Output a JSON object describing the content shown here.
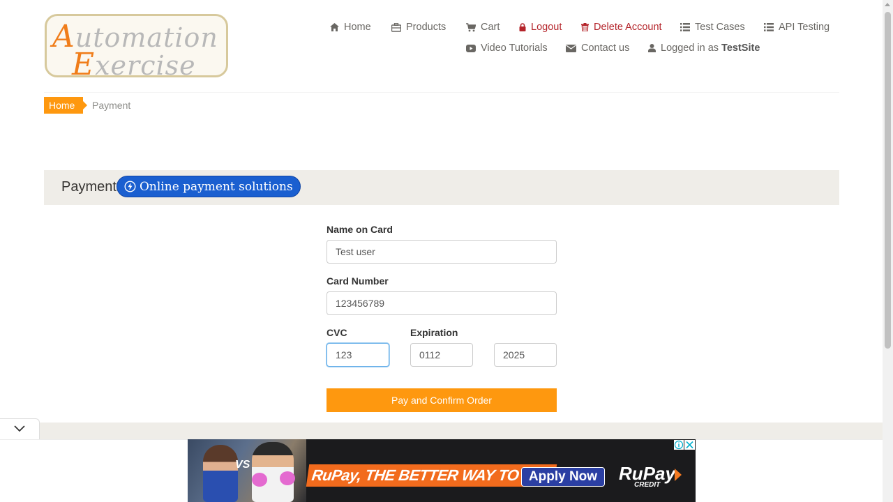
{
  "logo": {
    "line1_cap": "A",
    "line1_rest": "utomation",
    "line2_cap": "E",
    "line2_rest": "xercise"
  },
  "nav": {
    "home": "Home",
    "products": "Products",
    "cart": "Cart",
    "logout": "Logout",
    "delete_account": "Delete Account",
    "test_cases": "Test Cases",
    "api_testing": "API Testing",
    "video_tutorials": "Video Tutorials",
    "contact_us": "Contact us",
    "logged_in_prefix": "Logged in as",
    "logged_in_user": "TestSite"
  },
  "breadcrumb": {
    "home": "Home",
    "current": "Payment"
  },
  "section": {
    "title": "Payment",
    "ad_label": "Online payment solutions"
  },
  "form": {
    "name_label": "Name on Card",
    "name_value": "Test user",
    "card_label": "Card Number",
    "card_value": "123456789",
    "cvc_label": "CVC",
    "cvc_value": "123",
    "expiration_label": "Expiration",
    "exp_month_value": "0112",
    "exp_year_value": "2025",
    "submit_label": "Pay and Confirm Order"
  },
  "ad": {
    "vs": "VS",
    "tagline": "RuPay, THE BETTER WAY TO PAY",
    "cta": "Apply Now",
    "brand": "RuPay",
    "brand_sub": "CREDIT"
  },
  "colors": {
    "accent": "#fe980f",
    "danger": "#b4242a",
    "band": "#efede8",
    "ad_blue": "#1a5fd0"
  }
}
